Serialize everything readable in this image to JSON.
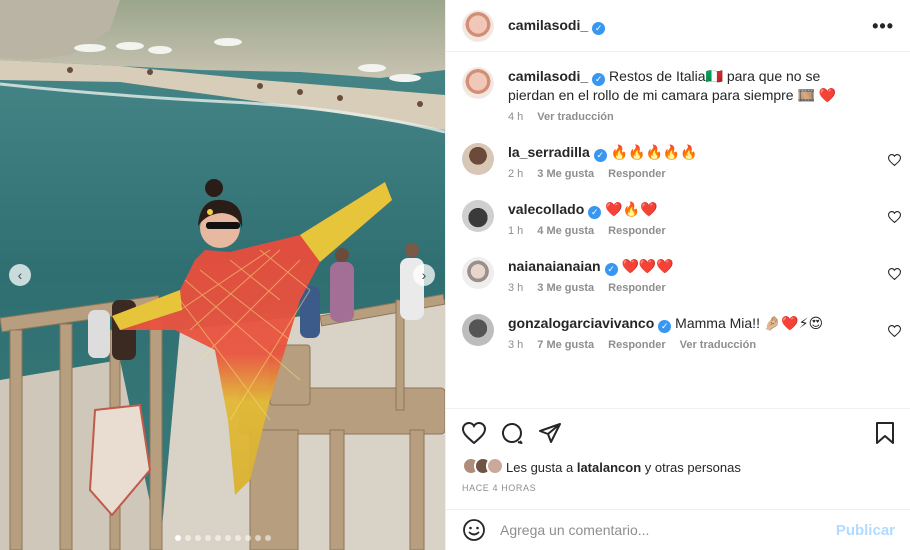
{
  "post": {
    "username": "camilasodi_",
    "more_label": "•••"
  },
  "caption": {
    "username": "camilasodi_",
    "text": "Restos de Italia🇮🇹 para que no se pierdan en el rollo de mi camara para siempre 🎞️ ❤️",
    "time": "4 h",
    "translate": "Ver traducción"
  },
  "comments": [
    {
      "username": "la_serradilla",
      "verified": true,
      "text": "🔥🔥🔥🔥🔥",
      "time": "2 h",
      "likes": "3 Me gusta",
      "reply": "Responder",
      "translate": ""
    },
    {
      "username": "valecollado",
      "verified": true,
      "text": "❤️🔥❤️",
      "time": "1 h",
      "likes": "4 Me gusta",
      "reply": "Responder",
      "translate": ""
    },
    {
      "username": "naianaianaian",
      "verified": true,
      "text": "❤️❤️❤️",
      "time": "3 h",
      "likes": "3 Me gusta",
      "reply": "Responder",
      "translate": ""
    },
    {
      "username": "gonzalogarciavivanco",
      "verified": true,
      "text": "Mamma Mia!! 🤌🏼❤️⚡😍",
      "time": "3 h",
      "likes": "7 Me gusta",
      "reply": "Responder",
      "translate": "Ver traducción"
    }
  ],
  "likes": {
    "prefix": "Les gusta a",
    "user": "latalancon",
    "suffix": "y otras personas"
  },
  "timestamp": "HACE 4 HORAS",
  "add_comment": {
    "placeholder": "Agrega un comentario...",
    "post_label": "Publicar"
  },
  "carousel": {
    "total_slides": 10,
    "active_index": 0
  },
  "colors": {
    "verified": "#3897f0",
    "post_button": "#b3dbff",
    "meta_text": "#8e8e8e"
  }
}
